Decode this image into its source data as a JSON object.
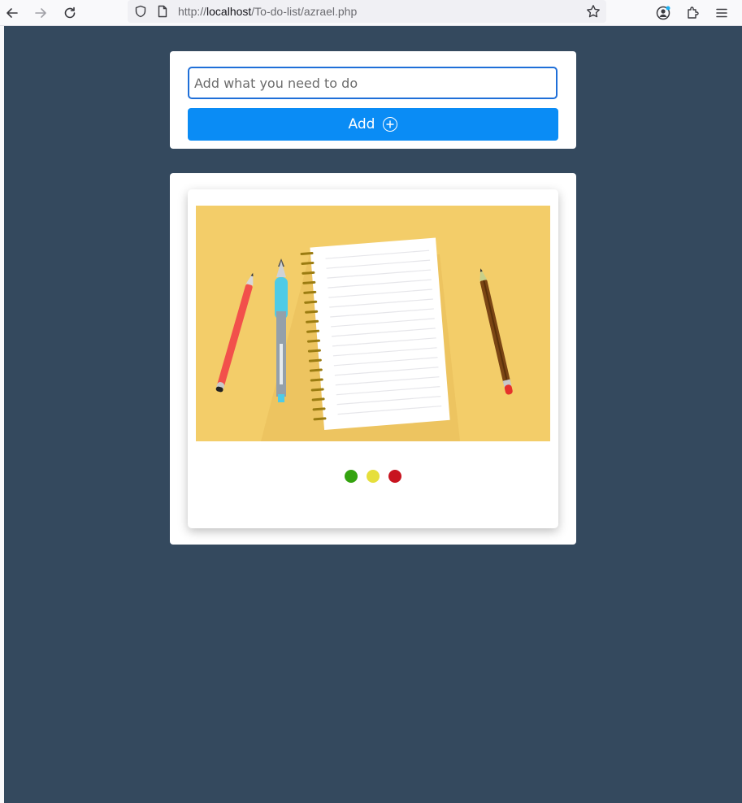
{
  "browser": {
    "url_scheme": "http://",
    "url_host": "localhost",
    "url_path": "/To-do-list/azrael.php",
    "icons": [
      "back-arrow-icon",
      "forward-arrow-icon",
      "reload-icon",
      "shield-icon",
      "page-icon",
      "star-icon",
      "account-icon",
      "extensions-icon",
      "menu-icon"
    ]
  },
  "todo": {
    "input_placeholder": "Add what you need to do",
    "input_value": "",
    "add_label": "Add"
  },
  "empty_state": {
    "illustration": "notebook-and-pens-illustration",
    "status_dots": [
      {
        "name": "green-dot",
        "color": "#34a30f"
      },
      {
        "name": "yellow-dot",
        "color": "#e6df3c"
      },
      {
        "name": "red-dot",
        "color": "#c8141f"
      }
    ]
  },
  "colors": {
    "page_background": "#34495e",
    "accent": "#0a8cf5",
    "illustration_background": "#f3cd69"
  }
}
